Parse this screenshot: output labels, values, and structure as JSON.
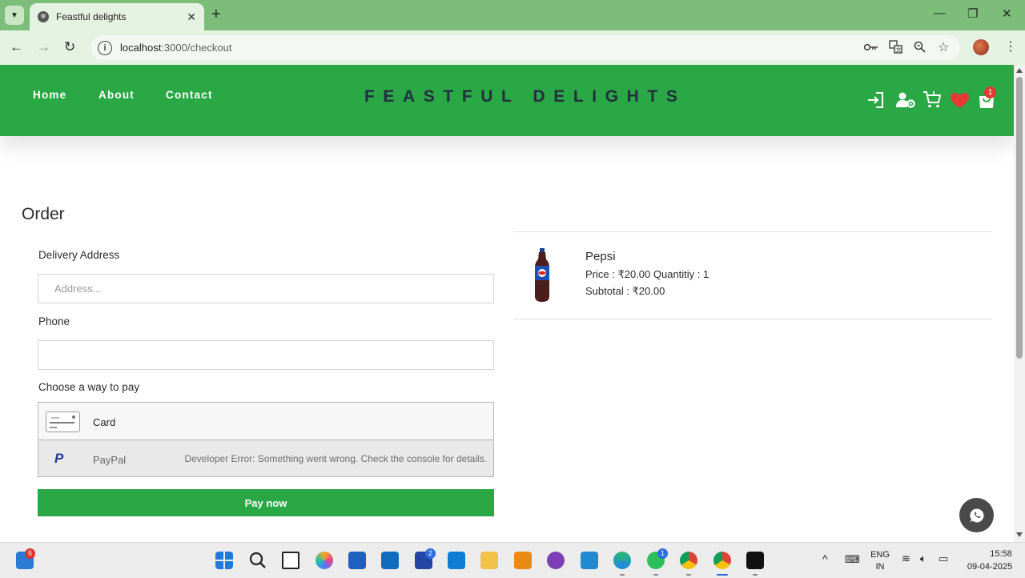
{
  "browser": {
    "tab_title": "Feastful delights",
    "tab_close": "✕",
    "new_tab": "+",
    "url_host": "localhost",
    "url_path": ":3000/checkout",
    "window_controls": [
      "—",
      "❐",
      "✕"
    ]
  },
  "site": {
    "nav": [
      "Home",
      "About",
      "Contact"
    ],
    "brand": "FEASTFUL DELIGHTS",
    "cart_count": "1"
  },
  "checkout": {
    "title": "Order",
    "address_label": "Delivery Address",
    "address_placeholder": "Address...",
    "phone_label": "Phone",
    "phone_value": "",
    "pay_label": "Choose a way to pay",
    "card_label": "Card",
    "paypal_label": "PayPal",
    "paypal_error": "Developer Error: Something went wrong. Check the console for details.",
    "pay_now": "Pay now"
  },
  "order_item": {
    "name": "Pepsi",
    "price_line": "Price : ₹20.00 Quantitiy : 1",
    "subtotal_line": "Subtotal : ₹20.00"
  },
  "taskbar": {
    "widgets_badge": "6",
    "l_app_badge": "2",
    "whatsapp_badge": "1",
    "language_top": "ENG",
    "language_bottom": "IN",
    "time": "15:58",
    "date": "09-04-2025"
  },
  "colors": {
    "tabstrip": "#7dbd7a",
    "toolbar": "#e5f2e2",
    "header_green": "#2aa845",
    "brand_text": "#233040",
    "favorite_red": "#e53935"
  },
  "icons": {
    "header": [
      "login-icon",
      "user-settings-icon",
      "cart-icon",
      "heart-icon",
      "shopping-bag-icon"
    ],
    "fab": "whatsapp-icon"
  }
}
